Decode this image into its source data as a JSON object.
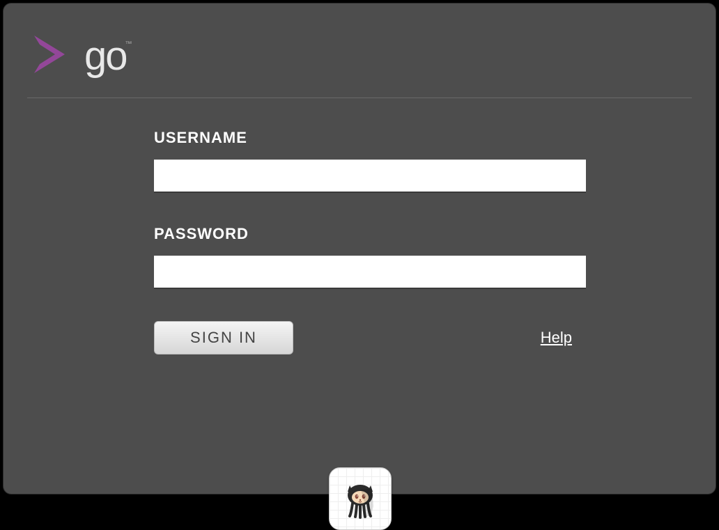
{
  "brand": {
    "name": "go",
    "trademark": "™",
    "accent_color": "#934799"
  },
  "form": {
    "username_label": "USERNAME",
    "username_value": "",
    "password_label": "PASSWORD",
    "password_value": "",
    "signin_label": "SIGN IN",
    "help_label": "Help"
  },
  "oauth": {
    "github_icon": "github-octocat"
  }
}
